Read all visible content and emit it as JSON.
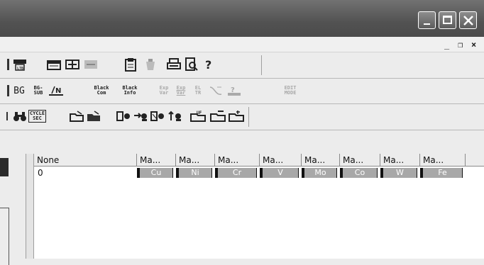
{
  "window": {
    "buttons": [
      "minimize-icon",
      "maximize-icon",
      "close-icon"
    ],
    "mdi_buttons": [
      "_",
      "❐",
      "×"
    ]
  },
  "toolbar_row2": {
    "bg_label": "BG",
    "bgsub_label": "BG-\nSUB",
    "black_com_label": "Black\nCom",
    "black_info_label": "Black\nInfo",
    "exp_var_label": "Exp\nVar",
    "el_tr_label": "EL\nTR",
    "edit_mode_label": "EDIT\nMODE"
  },
  "toolbar_row3": {
    "cycle_sec_label": "CYCLE\nSEC"
  },
  "table": {
    "columns": [
      "None",
      "Ma...",
      "Ma...",
      "Ma...",
      "Ma...",
      "Ma...",
      "Ma...",
      "Ma...",
      "Ma..."
    ],
    "row": {
      "first": "0",
      "elements": [
        "Cu",
        "Ni",
        "Cr",
        "V",
        "Mo",
        "Co",
        "W",
        "Fe"
      ]
    }
  },
  "colors": {
    "titlebar": "#555555",
    "element_cell": "#a8a8a8"
  }
}
